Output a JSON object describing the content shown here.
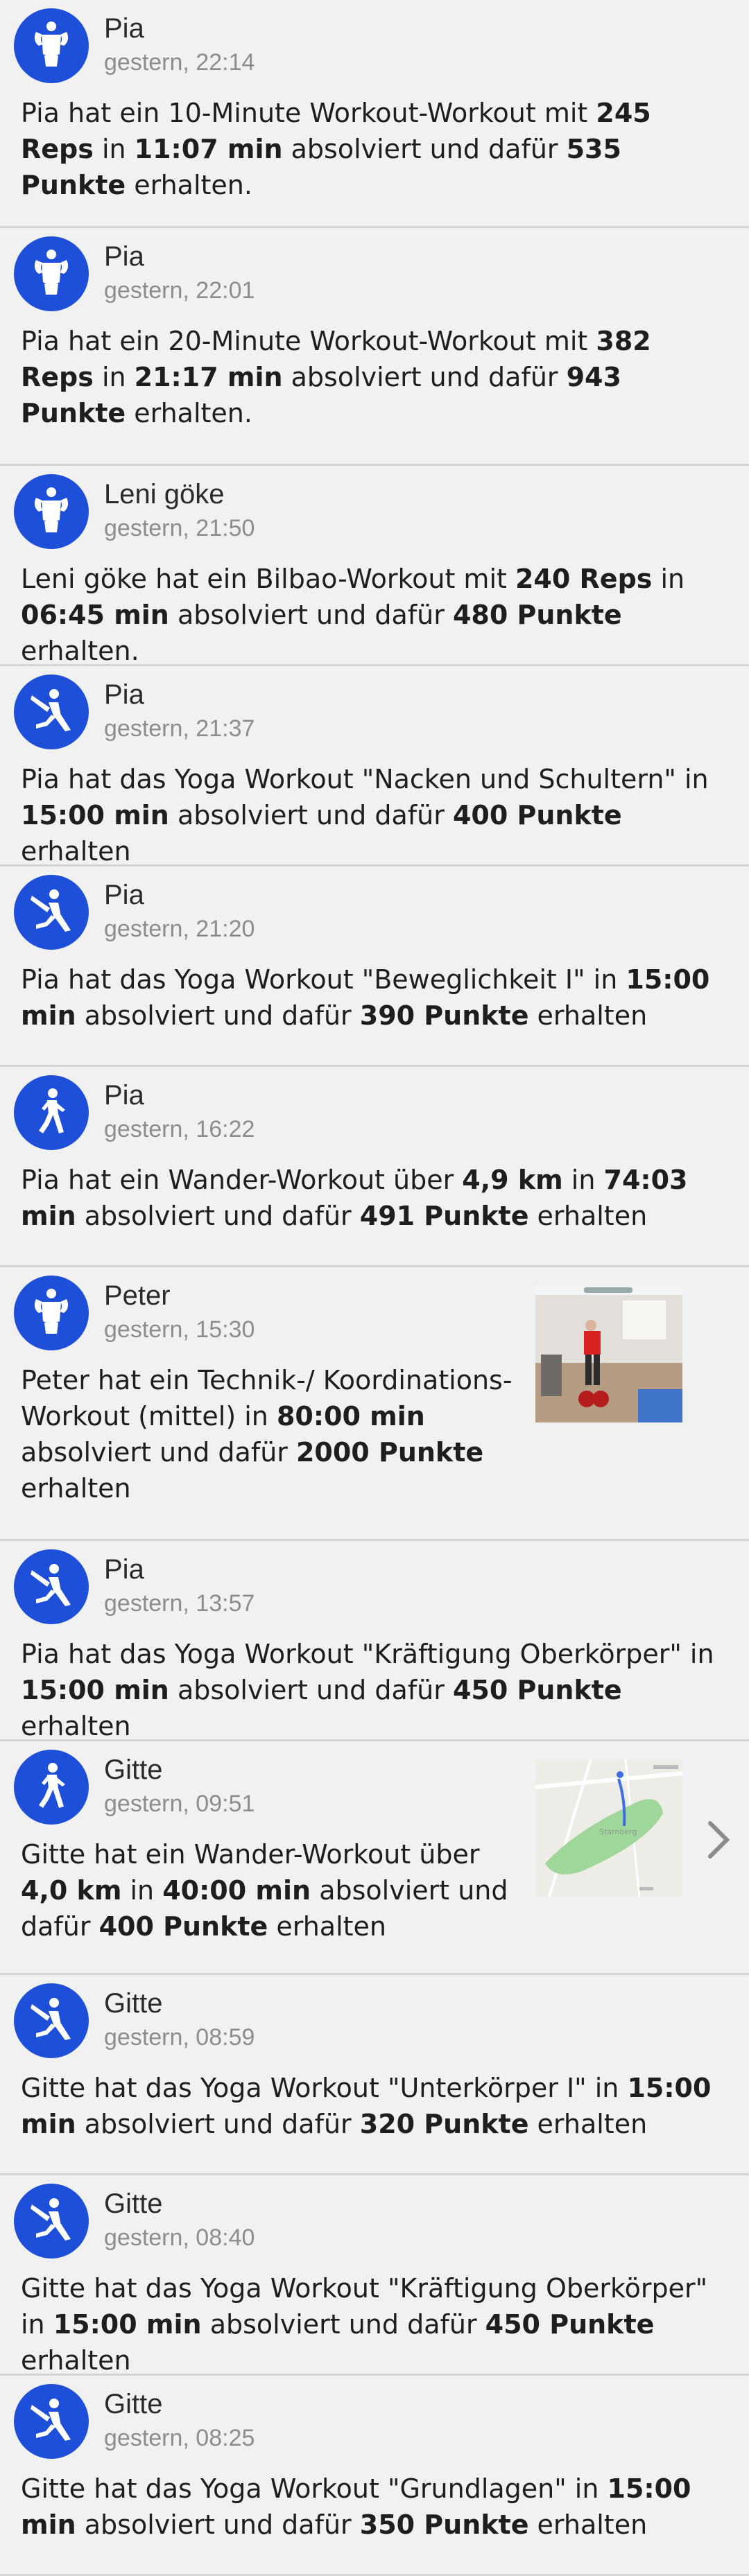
{
  "colors": {
    "background": "#f1f1f1",
    "avatar": "#1e4fd9",
    "divider": "#d4d4d4",
    "timestamp": "#8d8d8d"
  },
  "feed": [
    {
      "name": "Pia",
      "time": "gestern, 22:14",
      "icon": "strength-icon",
      "parts": [
        [
          "Pia hat ein 10-Minute Workout-Workout mit ",
          false
        ],
        [
          "245 Reps",
          true
        ],
        [
          " in ",
          false
        ],
        [
          "11:07 min",
          true
        ],
        [
          " absolviert und dafür ",
          false
        ],
        [
          "535 Punkte",
          true
        ],
        [
          " erhalten.",
          false
        ]
      ]
    },
    {
      "name": "Pia",
      "time": "gestern, 22:01",
      "icon": "strength-icon",
      "parts": [
        [
          "Pia hat ein 20-Minute Workout-Workout mit ",
          false
        ],
        [
          "382 Reps",
          true
        ],
        [
          " in ",
          false
        ],
        [
          "21:17 min",
          true
        ],
        [
          " absolviert und dafür ",
          false
        ],
        [
          "943 Punkte",
          true
        ],
        [
          " erhalten.",
          false
        ]
      ]
    },
    {
      "name": "Leni göke",
      "time": "gestern, 21:50",
      "icon": "strength-icon",
      "parts": [
        [
          "Leni göke hat ein Bilbao-Workout mit ",
          false
        ],
        [
          "240 Reps",
          true
        ],
        [
          " in ",
          false
        ],
        [
          "06:45 min",
          true
        ],
        [
          " absolviert und dafür ",
          false
        ],
        [
          "480 Punkte",
          true
        ],
        [
          " erhalten.",
          false
        ]
      ]
    },
    {
      "name": "Pia",
      "time": "gestern, 21:37",
      "icon": "yoga-icon",
      "parts": [
        [
          "Pia hat das Yoga Workout \"Nacken und Schultern\" in ",
          false
        ],
        [
          "15:00 min",
          true
        ],
        [
          " absolviert und dafür ",
          false
        ],
        [
          "400 Punkte",
          true
        ],
        [
          " erhalten",
          false
        ]
      ]
    },
    {
      "name": "Pia",
      "time": "gestern, 21:20",
      "icon": "yoga-icon",
      "parts": [
        [
          "Pia hat das Yoga Workout \"Beweglichkeit I\" in ",
          false
        ],
        [
          "15:00 min",
          true
        ],
        [
          " absolviert und dafür ",
          false
        ],
        [
          "390 Punkte",
          true
        ],
        [
          " erhalten",
          false
        ]
      ]
    },
    {
      "name": "Pia",
      "time": "gestern, 16:22",
      "icon": "hiking-icon",
      "parts": [
        [
          "Pia hat ein Wander-Workout über ",
          false
        ],
        [
          "4,9 km",
          true
        ],
        [
          " in ",
          false
        ],
        [
          "74:03 min",
          true
        ],
        [
          " absolviert und dafür ",
          false
        ],
        [
          "491 Punkte",
          true
        ],
        [
          " erhalten",
          false
        ]
      ]
    },
    {
      "name": "Peter",
      "time": "gestern, 15:30",
      "icon": "strength-icon",
      "attachment": "photo",
      "parts": [
        [
          "Peter hat ein Technik-/ Koordinations-Workout (mittel)  in ",
          false
        ],
        [
          "80:00 min",
          true
        ],
        [
          " absolviert und dafür ",
          false
        ],
        [
          "2000 Punkte",
          true
        ],
        [
          " erhalten",
          false
        ]
      ]
    },
    {
      "name": "Pia",
      "time": "gestern, 13:57",
      "icon": "yoga-icon",
      "parts": [
        [
          "Pia hat das Yoga Workout \"Kräftigung Oberkörper\" in ",
          false
        ],
        [
          "15:00 min",
          true
        ],
        [
          " absolviert und dafür ",
          false
        ],
        [
          "450 Punkte",
          true
        ],
        [
          " erhalten",
          false
        ]
      ]
    },
    {
      "name": "Gitte",
      "time": "gestern, 09:51",
      "icon": "hiking-icon",
      "attachment": "map",
      "map_label": "Starnberg",
      "chevron": true,
      "parts": [
        [
          "Gitte hat ein Wander-Workout über ",
          false
        ],
        [
          "4,0 km",
          true
        ],
        [
          " in ",
          false
        ],
        [
          "40:00 min",
          true
        ],
        [
          " absolviert und dafür ",
          false
        ],
        [
          "400 Punkte",
          true
        ],
        [
          " erhalten",
          false
        ]
      ]
    },
    {
      "name": "Gitte",
      "time": "gestern, 08:59",
      "icon": "yoga-icon",
      "parts": [
        [
          "Gitte hat das Yoga Workout \"Unterkörper I\" in ",
          false
        ],
        [
          "15:00 min",
          true
        ],
        [
          " absolviert und dafür ",
          false
        ],
        [
          "320 Punkte",
          true
        ],
        [
          " erhalten",
          false
        ]
      ]
    },
    {
      "name": "Gitte",
      "time": "gestern, 08:40",
      "icon": "yoga-icon",
      "parts": [
        [
          "Gitte hat das Yoga Workout \"Kräftigung Oberkörper\" in ",
          false
        ],
        [
          "15:00 min",
          true
        ],
        [
          " absolviert und dafür ",
          false
        ],
        [
          "450 Punkte",
          true
        ],
        [
          " erhalten",
          false
        ]
      ]
    },
    {
      "name": "Gitte",
      "time": "gestern, 08:25",
      "icon": "yoga-icon",
      "parts": [
        [
          "Gitte hat das Yoga Workout \"Grundlagen\" in ",
          false
        ],
        [
          "15:00 min",
          true
        ],
        [
          " absolviert und dafür ",
          false
        ],
        [
          "350 Punkte",
          true
        ],
        [
          " erhalten",
          false
        ]
      ]
    }
  ]
}
